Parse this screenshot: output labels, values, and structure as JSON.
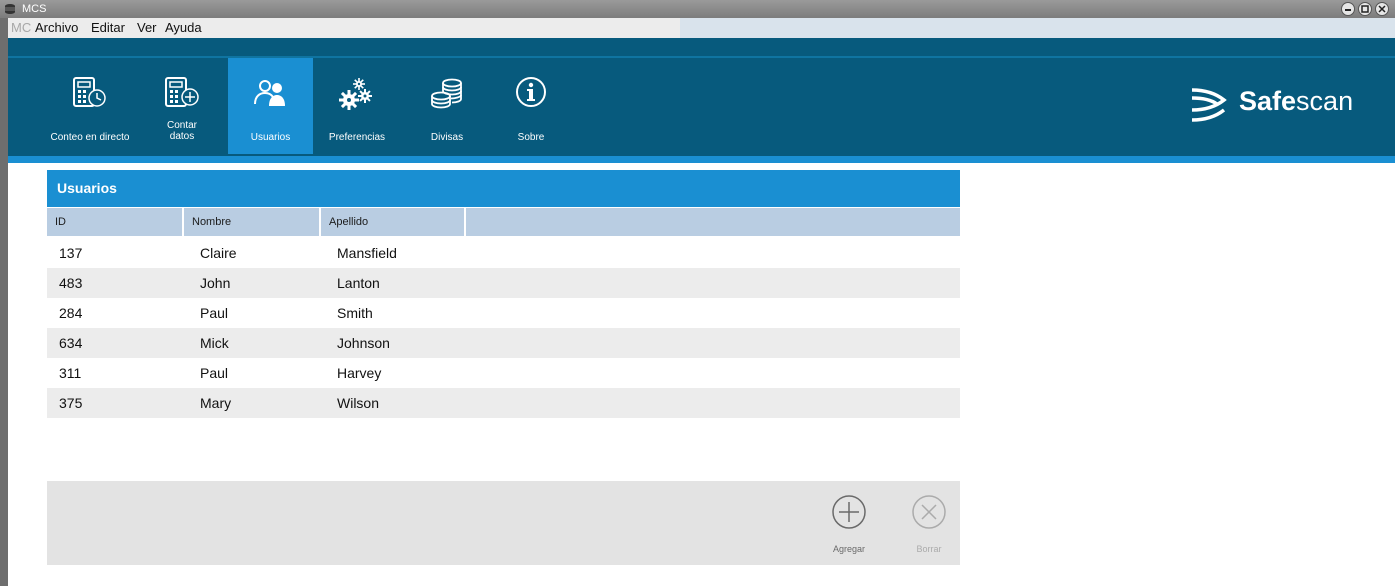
{
  "window": {
    "title": "MCS"
  },
  "menu": {
    "mc": "MC",
    "items": [
      "Archivo",
      "Editar",
      "Ver",
      "Ayuda"
    ]
  },
  "nav": {
    "items": [
      {
        "label": "Conteo en directo",
        "icon": "calculator-clock-icon"
      },
      {
        "label": "Contar datos",
        "icon": "calculator-plus-icon"
      },
      {
        "label": "Usuarios",
        "icon": "users-icon",
        "active": true
      },
      {
        "label": "Preferencias",
        "icon": "gears-icon"
      },
      {
        "label": "Divisas",
        "icon": "coins-icon"
      },
      {
        "label": "Sobre",
        "icon": "info-icon"
      }
    ]
  },
  "brand": {
    "bold": "Safe",
    "regular": "scan"
  },
  "panel": {
    "title": "Usuarios"
  },
  "table": {
    "columns": [
      "ID",
      "Nombre",
      "Apellido"
    ],
    "rows": [
      [
        "137",
        "Claire",
        "Mansfield"
      ],
      [
        "483",
        "John",
        "Lanton"
      ],
      [
        "284",
        "Paul",
        "Smith"
      ],
      [
        "634",
        "Mick",
        "Johnson"
      ],
      [
        "311",
        "Paul",
        "Harvey"
      ],
      [
        "375",
        "Mary",
        "Wilson"
      ]
    ]
  },
  "footer": {
    "add_label": "Agregar",
    "delete_label": "Borrar"
  },
  "colors": {
    "ribbon": "#075a7d",
    "accent": "#1a8fd2",
    "header_row": "#b9cde2"
  }
}
